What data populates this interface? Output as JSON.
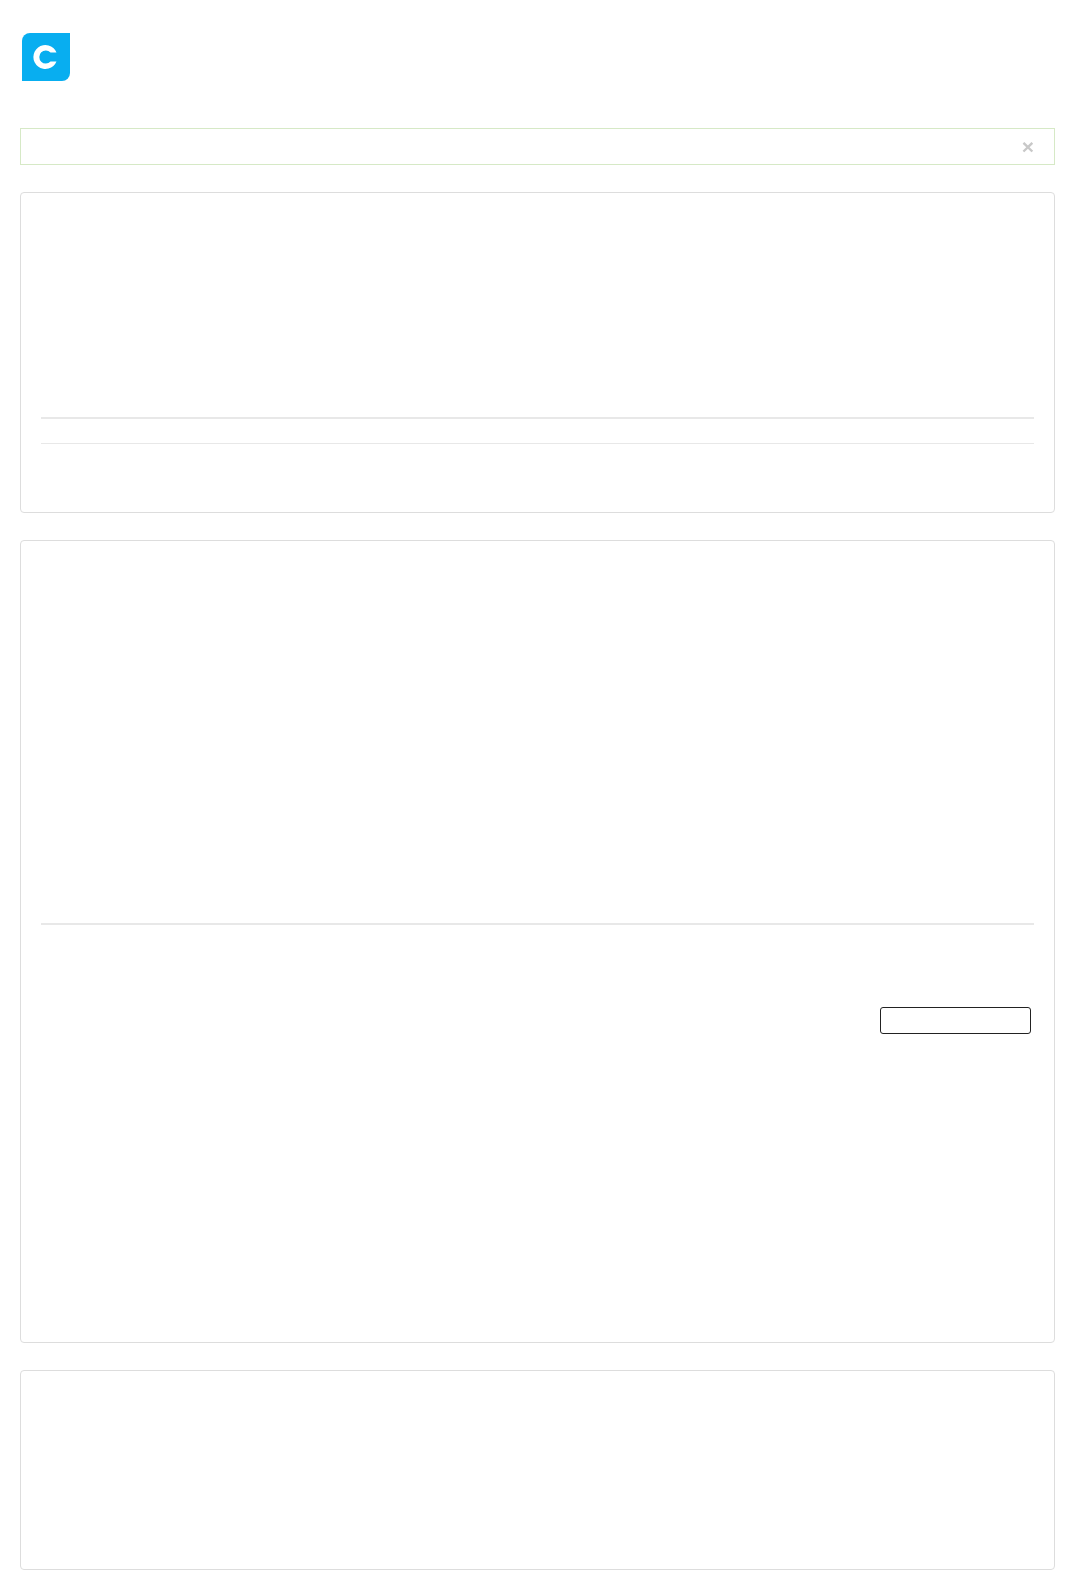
{
  "alert": {
    "close": "×"
  },
  "cards": [
    {
      "kind": "double-rule"
    },
    {
      "kind": "form"
    },
    {
      "kind": "plain"
    }
  ]
}
